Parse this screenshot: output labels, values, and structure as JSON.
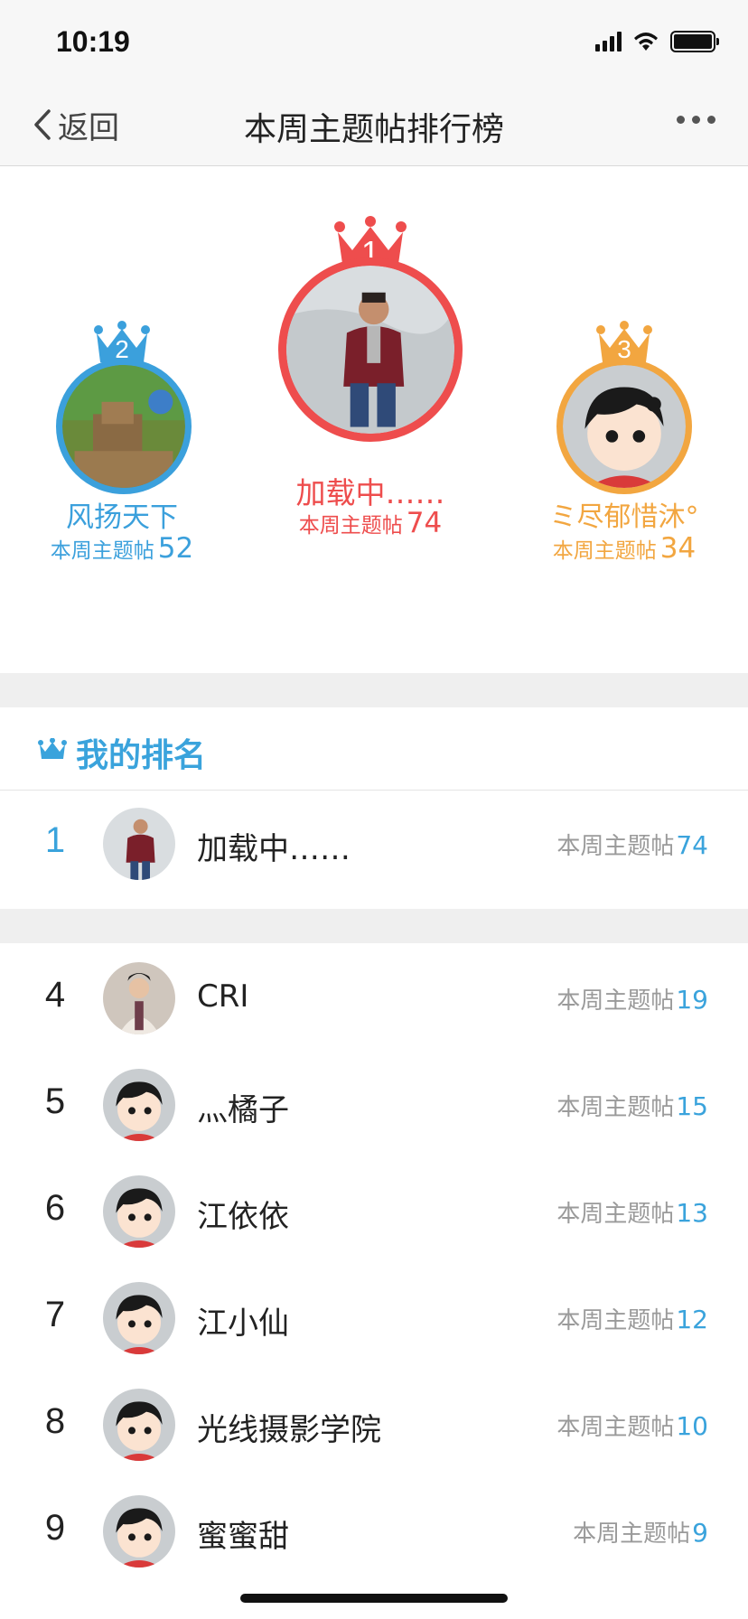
{
  "status_bar": {
    "time": "10:19"
  },
  "nav": {
    "back_label": "返回",
    "title": "本周主题帖排行榜"
  },
  "podium": [
    {
      "rank": "2",
      "name": "风扬天下",
      "count_label": "本周主题帖",
      "count": "52",
      "color": "#3ba0dc"
    },
    {
      "rank": "1",
      "name": "加载中……",
      "count_label": "本周主题帖",
      "count": "74",
      "color": "#ee4d4d"
    },
    {
      "rank": "3",
      "name": "ミ尽郁惜沐°",
      "count_label": "本周主题帖",
      "count": "34",
      "color": "#f2a640"
    }
  ],
  "my_rank": {
    "title": "我的排名",
    "rank": "1",
    "name": "加载中……",
    "count_label": "本周主题帖",
    "count": "74"
  },
  "list": [
    {
      "rank": "4",
      "name": "CRI",
      "count_label": "本周主题帖",
      "count": "19"
    },
    {
      "rank": "5",
      "name": "灬橘子",
      "count_label": "本周主题帖",
      "count": "15"
    },
    {
      "rank": "6",
      "name": "江依依",
      "count_label": "本周主题帖",
      "count": "13"
    },
    {
      "rank": "7",
      "name": "江小仙",
      "count_label": "本周主题帖",
      "count": "12"
    },
    {
      "rank": "8",
      "name": "光线摄影学院",
      "count_label": "本周主题帖",
      "count": "10"
    },
    {
      "rank": "9",
      "name": "蜜蜜甜",
      "count_label": "本周主题帖",
      "count": "9"
    }
  ],
  "colors": {
    "accent": "#3aa3dc",
    "gold": "#ee4d4d",
    "silver": "#3ba0dc",
    "bronze": "#f2a640"
  }
}
